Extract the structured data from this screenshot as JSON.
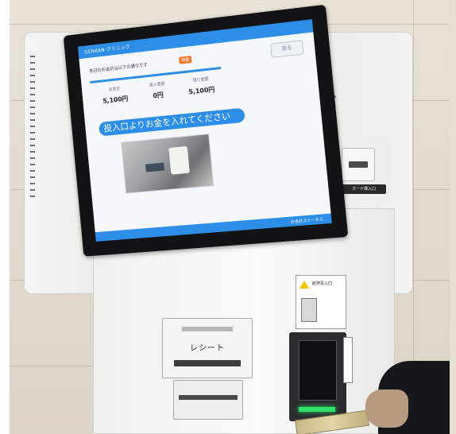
{
  "screen": {
    "brand": "GENKAN クリニック",
    "prompt": "本日のお会計は以下の通りです",
    "badge": "現金",
    "back_button": "戻る",
    "amounts": [
      {
        "label": "お会計",
        "value": "5,100円"
      },
      {
        "label": "投入金額",
        "value": "0円"
      },
      {
        "label": "残り金額",
        "value": "5,100円"
      }
    ],
    "instruction": "投入口よりお金を入れてください",
    "footer": "お会計ステータス"
  },
  "machine": {
    "receipt_label": "レシート",
    "card_reader_label": "カード挿入口",
    "notice_text": "紙幣投入口"
  },
  "colors": {
    "screen_accent": "#2c8ee6",
    "badge": "#f07a2c",
    "bill_led": "#2ee26a"
  }
}
